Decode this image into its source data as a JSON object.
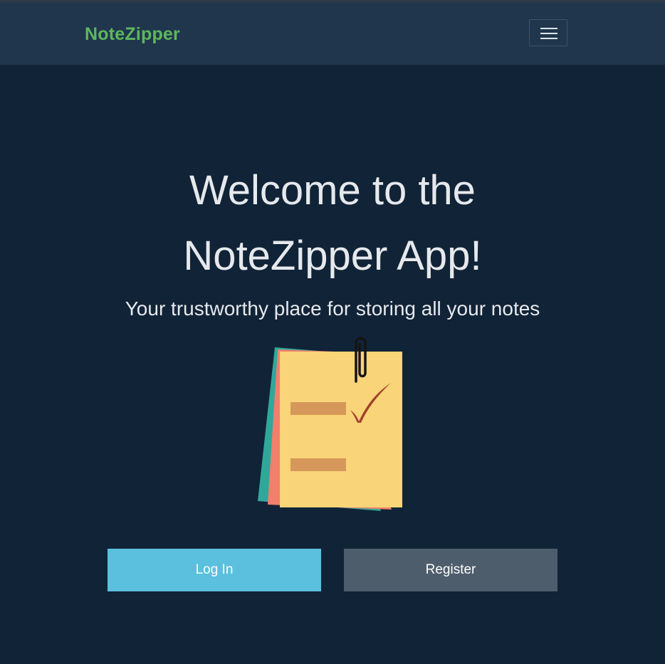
{
  "navbar": {
    "brand": "NoteZipper",
    "toggler_icon": "hamburger-menu-icon"
  },
  "landing": {
    "title_line1": "Welcome to the",
    "title_line2": "NoteZipper App!",
    "subtitle": "Your trustworthy place for storing all your notes",
    "illustration_icon": "sticky-notes-checklist-icon",
    "login_label": "Log In",
    "register_label": "Register"
  },
  "colors": {
    "background": "#112337",
    "navbar": "#20364d",
    "brand": "#5cb85c",
    "login_button": "#5bc0de",
    "register_button": "#4e5d6c"
  }
}
